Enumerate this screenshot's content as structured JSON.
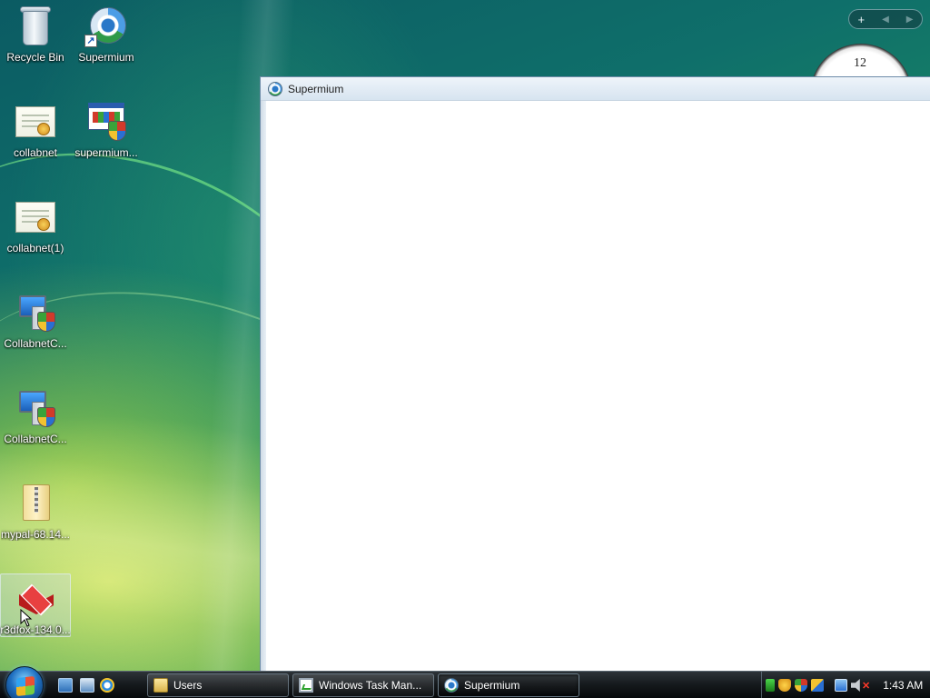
{
  "desktop": {
    "icons": [
      {
        "label": "Recycle Bin",
        "icon": "recycle-bin-icon"
      },
      {
        "label": "Supermium",
        "icon": "supermium-shortcut-icon"
      },
      {
        "label": "collabnet",
        "icon": "certificate-icon"
      },
      {
        "label": "supermium...",
        "icon": "installer-window-icon"
      },
      {
        "label": "collabnet(1)",
        "icon": "certificate-icon"
      },
      {
        "label": "CollabnetC...",
        "icon": "installer-computer-icon"
      },
      {
        "label": "CollabnetC...",
        "icon": "installer-computer-icon"
      },
      {
        "label": "mypal-68.14...",
        "icon": "zip-folder-icon"
      },
      {
        "label": "r3dfox-134.0...",
        "icon": "r3dfox-cube-icon"
      }
    ],
    "selected_icon": "r3dfox-134.0..."
  },
  "gadgets": {
    "add_symbol": "+",
    "prev_symbol": "◀",
    "next_symbol": "▶",
    "clock_number": "12"
  },
  "window": {
    "title": "Supermium",
    "icon": "supermium-icon"
  },
  "taskbar": {
    "start_icon": "windows-start-orb-icon",
    "quick_launch": [
      "show-desktop-icon",
      "switch-windows-icon",
      "internet-explorer-icon"
    ],
    "buttons": [
      {
        "label": "Users",
        "icon": "folder-icon",
        "active": false
      },
      {
        "label": "Windows Task Man...",
        "icon": "task-manager-icon",
        "active": false
      },
      {
        "label": "Supermium",
        "icon": "supermium-icon",
        "active": true
      }
    ],
    "tray_icons": [
      "battery-meter-icon",
      "security-alert-icon",
      "security-shield-icon",
      "windows-update-icon",
      "network-icon",
      "volume-muted-icon"
    ],
    "clock": "1:43 AM"
  },
  "colors": {
    "taskbar": "#15191c",
    "window_titlebar": "#d7e4f0",
    "wallpaper_dark": "#0b5b63",
    "wallpaper_light": "#c9d84a"
  }
}
